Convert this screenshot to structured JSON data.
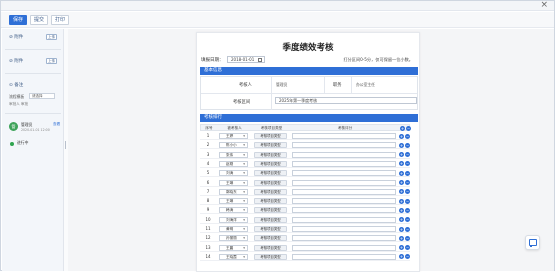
{
  "window": {
    "close_label": "×"
  },
  "toolbar": {
    "btn1": "保存",
    "btn2": "提交",
    "btn3": "打印"
  },
  "left_panel": {
    "row1_label": "附件",
    "row1_btn": "上传",
    "row2_label": "附件",
    "row2_btn": "上传",
    "remark_label": "备注",
    "select_label": "流程模板",
    "select_value": "请选择",
    "sub_text": "审批人 审批",
    "user_name": "管理员",
    "user_time": "2020-01-01 12:00",
    "user_action": "查看",
    "status_text": "进行中"
  },
  "doc": {
    "title": "季度绩效考核",
    "date_label": "填报日期：",
    "date_value": "2018-01-01",
    "hint": "打分区间0-5分，仅可保留一位小数。",
    "basic_section": "基本信息",
    "assessor_label": "考核人",
    "assessor_value": "管理员",
    "position_label": "职务",
    "position_value": "办公室主任",
    "period_label": "考核区间",
    "period_value": "2025年第一季度考核",
    "ranking_section": "考核排行",
    "headers": {
      "no": "序号",
      "person": "被考核人",
      "type": "考核项目类型",
      "score": "考核评分"
    },
    "rows": [
      {
        "no": "1",
        "person": "王婷",
        "tag": "考核项目类型"
      },
      {
        "no": "2",
        "person": "陈小小",
        "tag": "考核项目类型"
      },
      {
        "no": "3",
        "person": "张伟",
        "tag": "考核项目类型"
      },
      {
        "no": "4",
        "person": "赵刚",
        "tag": "考核项目类型"
      },
      {
        "no": "5",
        "person": "刘涛",
        "tag": "考核项目类型"
      },
      {
        "no": "6",
        "person": "王琳",
        "tag": "考核项目类型"
      },
      {
        "no": "7",
        "person": "郭晓东",
        "tag": "考核项目类型"
      },
      {
        "no": "8",
        "person": "王琳",
        "tag": "考核项目类型"
      },
      {
        "no": "9",
        "person": "韩涛",
        "tag": "考核项目类型"
      },
      {
        "no": "10",
        "person": "刘海洋",
        "tag": "考核项目类型"
      },
      {
        "no": "11",
        "person": "黄明",
        "tag": "考核项目类型"
      },
      {
        "no": "12",
        "person": "孙丽丽",
        "tag": "考核项目类型"
      },
      {
        "no": "13",
        "person": "王晨",
        "tag": "考核项目类型"
      },
      {
        "no": "14",
        "person": "王晓霞",
        "tag": "考核项目类型"
      }
    ]
  },
  "colors": {
    "accent": "#2f6fd6",
    "section_bar": "#2f6fd6",
    "status_green": "#2fa44f"
  }
}
